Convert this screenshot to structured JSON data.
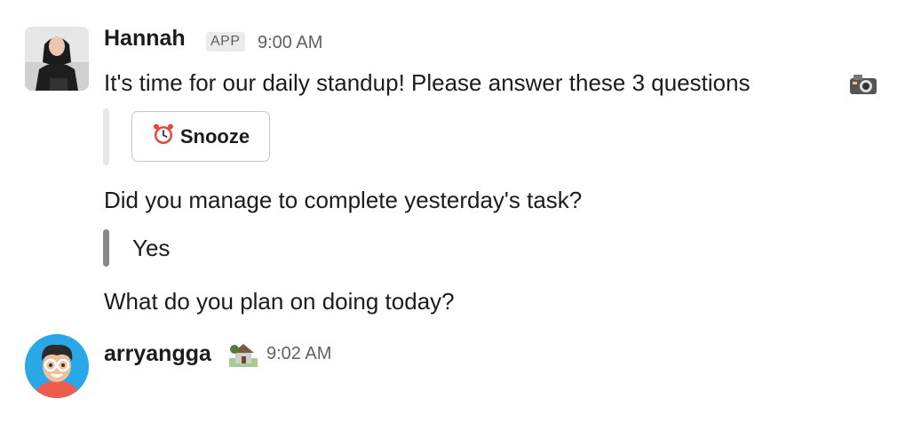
{
  "messages": [
    {
      "sender": "Hannah",
      "badge": "APP",
      "time": "9:00 AM",
      "text": "It's time for our daily standup! Please answer these 3 questions",
      "trailing_icon": "camera-with-flash-icon",
      "attachment_button": {
        "icon": "alarm-clock-icon",
        "label": "Snooze"
      },
      "question_1": "Did you manage to complete yesterday's task?",
      "answer_1": "Yes",
      "question_2": "What do you plan on doing today?"
    },
    {
      "sender": "arryangga",
      "status_icon": "house-with-garden-icon",
      "time": "9:02 AM"
    }
  ],
  "colors": {
    "text": "#1d1c1d",
    "muted": "#616061",
    "attachment_bar_light": "#e8e8e8",
    "answer_bar": "#868a86",
    "avatar2_bg": "#2aa7e6"
  }
}
